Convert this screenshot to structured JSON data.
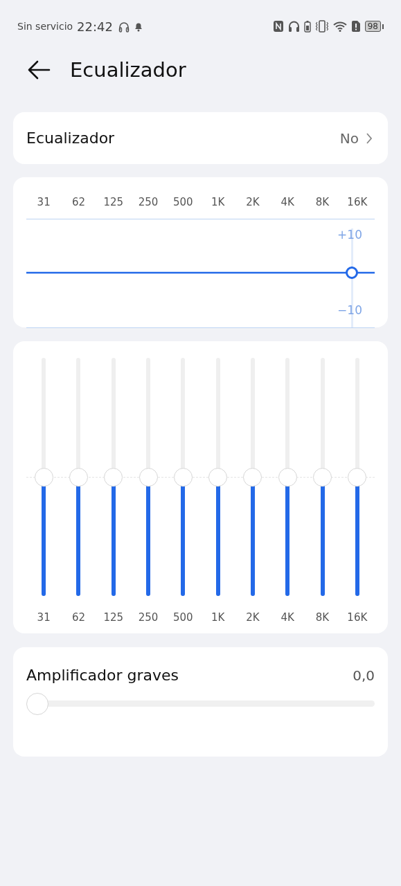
{
  "status_bar": {
    "carrier": "Sin servicio",
    "time": "22:42",
    "battery": "98"
  },
  "header": {
    "title": "Ecualizador"
  },
  "equalizer_setting": {
    "label": "Ecualizador",
    "value": "No"
  },
  "curve": {
    "bands": [
      "31",
      "62",
      "125",
      "250",
      "500",
      "1K",
      "2K",
      "4K",
      "8K",
      "16K"
    ],
    "gain_top": "+10",
    "gain_bottom": "−10"
  },
  "bands": [
    {
      "label": "31",
      "level": 0.5
    },
    {
      "label": "62",
      "level": 0.5
    },
    {
      "label": "125",
      "level": 0.5
    },
    {
      "label": "250",
      "level": 0.5
    },
    {
      "label": "500",
      "level": 0.5
    },
    {
      "label": "1K",
      "level": 0.5
    },
    {
      "label": "2K",
      "level": 0.5
    },
    {
      "label": "4K",
      "level": 0.5
    },
    {
      "label": "8K",
      "level": 0.5
    },
    {
      "label": "16K",
      "level": 0.5
    }
  ],
  "bass": {
    "label": "Amplificador graves",
    "reading": "0,0",
    "level": 0
  }
}
